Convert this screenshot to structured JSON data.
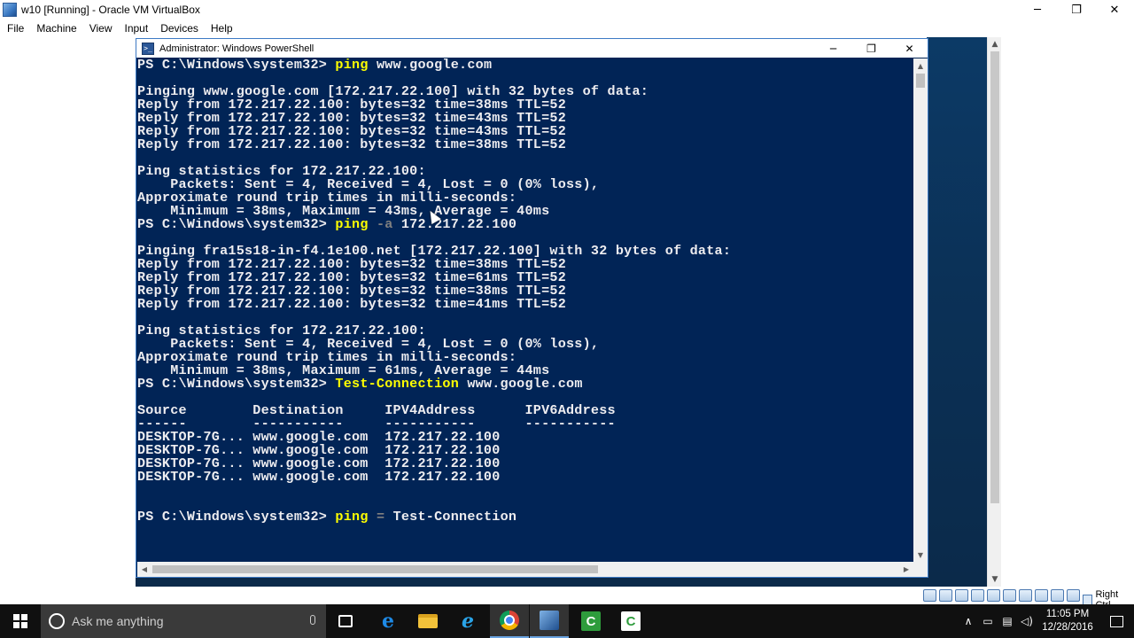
{
  "host": {
    "title": "w10 [Running] - Oracle VM VirtualBox",
    "controls": {
      "minimize": "─",
      "restore": "❐",
      "close": "✕"
    },
    "menu": [
      "File",
      "Machine",
      "View",
      "Input",
      "Devices",
      "Help"
    ],
    "status": {
      "host_key": "Right Ctrl"
    }
  },
  "powershell": {
    "title": "Administrator: Windows PowerShell",
    "controls": {
      "minimize": "─",
      "restore": "❐",
      "close": "✕"
    },
    "colors": {
      "background": "#012456",
      "text": "#eeedf0",
      "command": "#ffff00",
      "parameter": "#808080"
    },
    "lines": [
      [
        {
          "t": "PS C:\\Windows\\system32> ",
          "c": "default"
        },
        {
          "t": "ping ",
          "c": "cmd"
        },
        {
          "t": "www.google.com",
          "c": "default"
        }
      ],
      [],
      [
        {
          "t": "Pinging www.google.com [172.217.22.100] with 32 bytes of data:",
          "c": "default"
        }
      ],
      [
        {
          "t": "Reply from 172.217.22.100: bytes=32 time=38ms TTL=52",
          "c": "default"
        }
      ],
      [
        {
          "t": "Reply from 172.217.22.100: bytes=32 time=43ms TTL=52",
          "c": "default"
        }
      ],
      [
        {
          "t": "Reply from 172.217.22.100: bytes=32 time=43ms TTL=52",
          "c": "default"
        }
      ],
      [
        {
          "t": "Reply from 172.217.22.100: bytes=32 time=38ms TTL=52",
          "c": "default"
        }
      ],
      [],
      [
        {
          "t": "Ping statistics for 172.217.22.100:",
          "c": "default"
        }
      ],
      [
        {
          "t": "    Packets: Sent = 4, Received = 4, Lost = 0 (0% loss),",
          "c": "default"
        }
      ],
      [
        {
          "t": "Approximate round trip times in milli-seconds:",
          "c": "default"
        }
      ],
      [
        {
          "t": "    Minimum = 38ms, Maximum = 43ms, Average = 40ms",
          "c": "default"
        }
      ],
      [
        {
          "t": "PS C:\\Windows\\system32> ",
          "c": "default"
        },
        {
          "t": "ping ",
          "c": "cmd"
        },
        {
          "t": "-a ",
          "c": "param"
        },
        {
          "t": "172.217.22.100",
          "c": "default"
        }
      ],
      [],
      [
        {
          "t": "Pinging fra15s18-in-f4.1e100.net [172.217.22.100] with 32 bytes of data:",
          "c": "default"
        }
      ],
      [
        {
          "t": "Reply from 172.217.22.100: bytes=32 time=38ms TTL=52",
          "c": "default"
        }
      ],
      [
        {
          "t": "Reply from 172.217.22.100: bytes=32 time=61ms TTL=52",
          "c": "default"
        }
      ],
      [
        {
          "t": "Reply from 172.217.22.100: bytes=32 time=38ms TTL=52",
          "c": "default"
        }
      ],
      [
        {
          "t": "Reply from 172.217.22.100: bytes=32 time=41ms TTL=52",
          "c": "default"
        }
      ],
      [],
      [
        {
          "t": "Ping statistics for 172.217.22.100:",
          "c": "default"
        }
      ],
      [
        {
          "t": "    Packets: Sent = 4, Received = 4, Lost = 0 (0% loss),",
          "c": "default"
        }
      ],
      [
        {
          "t": "Approximate round trip times in milli-seconds:",
          "c": "default"
        }
      ],
      [
        {
          "t": "    Minimum = 38ms, Maximum = 61ms, Average = 44ms",
          "c": "default"
        }
      ],
      [
        {
          "t": "PS C:\\Windows\\system32> ",
          "c": "default"
        },
        {
          "t": "Test-Connection ",
          "c": "cmd"
        },
        {
          "t": "www.google.com",
          "c": "default"
        }
      ],
      [],
      [
        {
          "t": "Source        Destination     IPV4Address      IPV6Address",
          "c": "default"
        }
      ],
      [
        {
          "t": "------        -----------     -----------      -----------",
          "c": "default"
        }
      ],
      [
        {
          "t": "DESKTOP-7G... www.google.com  172.217.22.100",
          "c": "default"
        }
      ],
      [
        {
          "t": "DESKTOP-7G... www.google.com  172.217.22.100",
          "c": "default"
        }
      ],
      [
        {
          "t": "DESKTOP-7G... www.google.com  172.217.22.100",
          "c": "default"
        }
      ],
      [
        {
          "t": "DESKTOP-7G... www.google.com  172.217.22.100",
          "c": "default"
        }
      ],
      [],
      [],
      [
        {
          "t": "PS C:\\Windows\\system32> ",
          "c": "default"
        },
        {
          "t": "ping ",
          "c": "cmd"
        },
        {
          "t": "= ",
          "c": "param"
        },
        {
          "t": "Test-Connection",
          "c": "default"
        }
      ]
    ]
  },
  "taskbar": {
    "search_placeholder": "Ask me anything",
    "apps": [
      {
        "name": "task-view",
        "icon": "task-view-icon",
        "glyph": ""
      },
      {
        "name": "edge",
        "icon": "edge-icon",
        "glyph": "e"
      },
      {
        "name": "file-explorer",
        "icon": "folder-icon",
        "glyph": ""
      },
      {
        "name": "internet-explorer",
        "icon": "internet-explorer-icon",
        "glyph": "e"
      },
      {
        "name": "chrome",
        "icon": "chrome-icon",
        "glyph": ""
      },
      {
        "name": "virtualbox",
        "icon": "virtualbox-icon",
        "glyph": ""
      },
      {
        "name": "camtasia-recorder",
        "icon": "camtasia-icon",
        "glyph": "C"
      },
      {
        "name": "camtasia-studio",
        "icon": "camtasia-studio-icon",
        "glyph": "C"
      }
    ],
    "tray": {
      "chevron": "∧",
      "clock_time": "11:05 PM",
      "clock_date": "12/28/2016"
    }
  }
}
